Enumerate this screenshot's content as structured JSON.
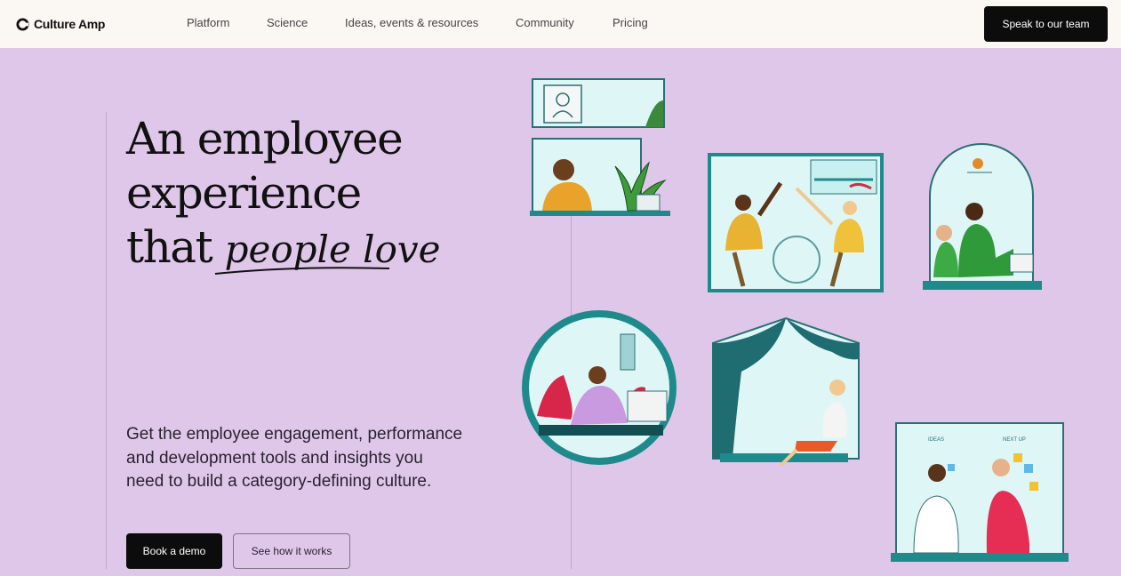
{
  "nav": {
    "logo_text": "Culture Amp",
    "links": [
      "Platform",
      "Science",
      "Ideas, events & resources",
      "Community",
      "Pricing"
    ],
    "cta_label": "Speak to our team"
  },
  "hero": {
    "headline_line1": "An employee",
    "headline_line2": "experience",
    "headline_line3_prefix": "that",
    "headline_line3_script": "people love",
    "subheadline": "Get the employee engagement, performance and development tools and insights you need to build a category-defining culture.",
    "primary_button": "Book a demo",
    "secondary_button": "See how it works"
  },
  "colors": {
    "background": "#dfc7ea",
    "nav_background": "#fbf8f4",
    "button": "#0c0c0c",
    "teal": "#1f8a8c"
  },
  "illustrations": {
    "board_label_left": "IDEAS",
    "board_label_right": "NEXT UP"
  }
}
